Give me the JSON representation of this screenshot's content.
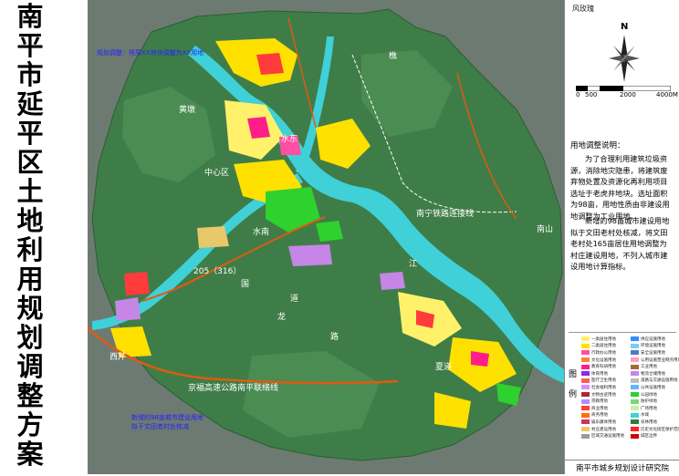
{
  "title": "南平市延平区土地利用规划调整方案",
  "title_chars": [
    "南",
    "平",
    "市",
    "延",
    "平",
    "区",
    "土",
    "地",
    "利",
    "用",
    "规",
    "划",
    "调",
    "整",
    "方",
    "案"
  ],
  "map": {
    "places": {
      "huangdun": "黄墩",
      "shuidong": "水东",
      "zhongxinqu": "中心区",
      "shuinan": "水南",
      "nanshan": "南山",
      "xifu": "西芹",
      "xiadao": "夏道",
      "jiao": "樵",
      "road_205": "205（316）",
      "expressway": "京福高速公路南平联络线",
      "railway": "南宁铁路连接线",
      "guo": "国",
      "dao": "道",
      "long": "龙",
      "lu": "路",
      "jiang": "江"
    },
    "annotations": {
      "top_1": "规划调整：将原XX地块调整为XX用地",
      "bottom_1": "新增的98亩城市建设用地",
      "bottom_2": "拟于文田老村处核减"
    }
  },
  "compass": {
    "label": "风玫瑰",
    "north": "N",
    "scale_ticks": [
      "0",
      "500",
      "2000",
      "4000M"
    ]
  },
  "notes": {
    "title": "用地调整说明：",
    "p1": "为了合理利用建筑垃圾资源，消除地灾隐患，将建筑废弃物处置及资源化再利用项目选址于老虎井地块。选址面积为98亩，用地性质由非建设用地调整为工业用地。",
    "p2": "新增的98亩城市建设用地拟于文田老村处核减，将文田老村处165亩居住用地调整为村庄建设用地，不列入城市建设用地计算指标。"
  },
  "legend": {
    "tag": "图例",
    "left": [
      {
        "label": "一类居住用地",
        "color": "#fff26a"
      },
      {
        "label": "二类居住用地",
        "color": "#ffe100"
      },
      {
        "label": "行政办公用地",
        "color": "#ff4fa3"
      },
      {
        "label": "文化设施用地",
        "color": "#ff7f3a"
      },
      {
        "label": "教育科研用地",
        "color": "#ff1d8a"
      },
      {
        "label": "体育用地",
        "color": "#8a2be2"
      },
      {
        "label": "医疗卫生用地",
        "color": "#ff5a5a"
      },
      {
        "label": "社会福利用地",
        "color": "#d98cff"
      },
      {
        "label": "文物古迹用地",
        "color": "#a52a2a"
      },
      {
        "label": "宗教用地",
        "color": "#b08cff"
      },
      {
        "label": "商业用地",
        "color": "#ff3b3b"
      },
      {
        "label": "商务用地",
        "color": "#ff6f00"
      },
      {
        "label": "娱乐康体用地",
        "color": "#cc3366"
      },
      {
        "label": "村庄建设用地",
        "color": "#e7c86a"
      },
      {
        "label": "区域交通设施用地",
        "color": "#9a9a9a"
      }
    ],
    "right": [
      {
        "label": "供应设施用地",
        "color": "#2f8fff"
      },
      {
        "label": "环境设施用地",
        "color": "#7acdf0"
      },
      {
        "label": "安全设施用地",
        "color": "#4d7cc7"
      },
      {
        "label": "公用设施营业网点用地",
        "color": "#ff9fbf"
      },
      {
        "label": "工业用地",
        "color": "#a7683a"
      },
      {
        "label": "物流仓储用地",
        "color": "#c586e8"
      },
      {
        "label": "道路与交通设施用地",
        "color": "#bdbdbd"
      },
      {
        "label": "公共设施用地",
        "color": "#5fb8ff"
      },
      {
        "label": "公园绿地",
        "color": "#2ed12e"
      },
      {
        "label": "防护绿地",
        "color": "#7bd67b"
      },
      {
        "label": "广场用地",
        "color": "#c8f0a0"
      },
      {
        "label": "水域",
        "color": "#3fd0d8"
      },
      {
        "label": "农林用地",
        "color": "#2f7d3a"
      },
      {
        "label": "历史文化街区保护范围",
        "color": "#ff2020"
      },
      {
        "label": "城区边界",
        "color": "#cc0000"
      }
    ]
  },
  "institute": "南平市城乡规划设计研究院",
  "colors": {
    "river": "#3fd0d8",
    "forest": "#3f7d48",
    "terrain": "#6f7d74",
    "road": "#e05a10"
  }
}
